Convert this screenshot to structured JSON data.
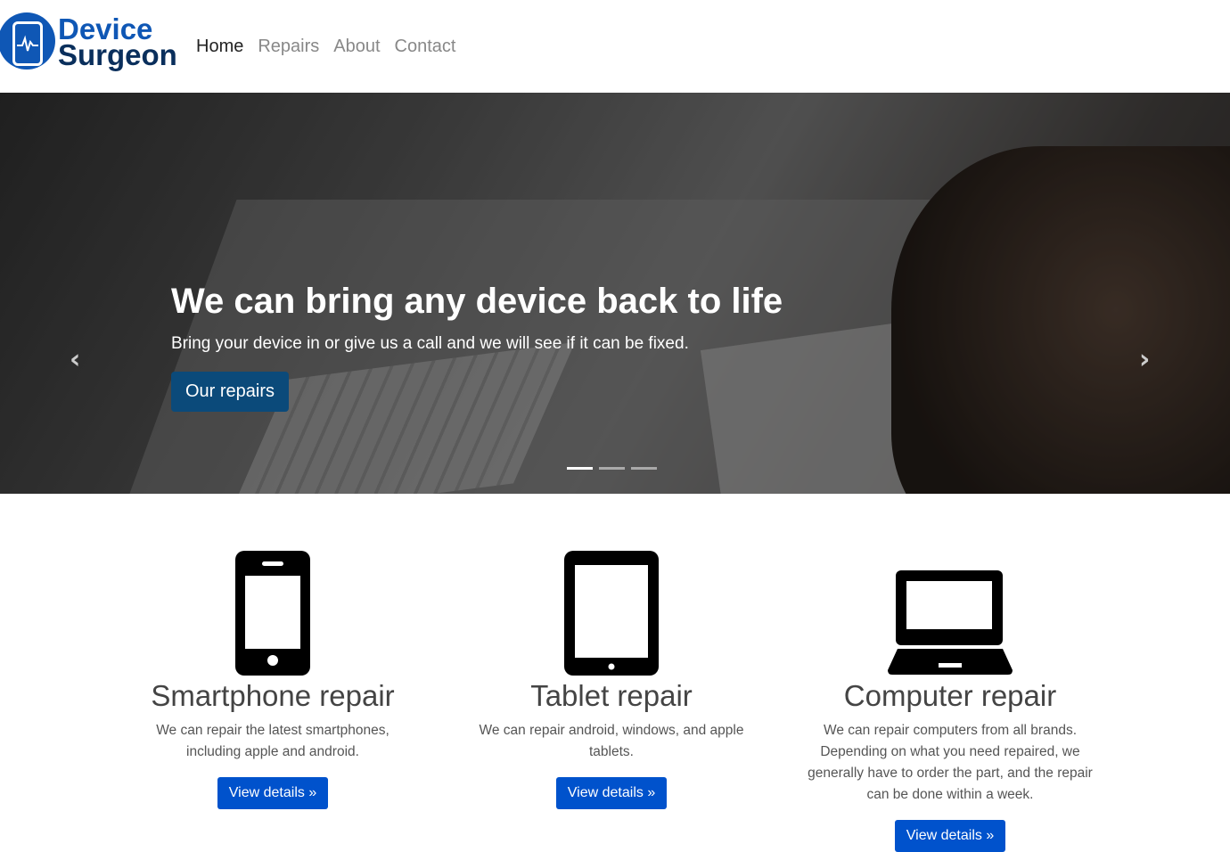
{
  "brand": {
    "line1": "Device",
    "line2": "Surgeon"
  },
  "nav": [
    {
      "label": "Home",
      "active": true
    },
    {
      "label": "Repairs"
    },
    {
      "label": "About"
    },
    {
      "label": "Contact"
    }
  ],
  "hero": {
    "title": "We can bring any device back to life",
    "subtitle": "Bring your device in or give us a call and we will see if it can be fixed.",
    "button": "Our repairs",
    "prev": "‹",
    "next": "›",
    "slides": 3,
    "active_slide": 1
  },
  "services": [
    {
      "icon": "smartphone-icon",
      "title": "Smartphone repair",
      "text": "We can repair the latest smartphones, including apple and android.",
      "button": "View details »"
    },
    {
      "icon": "tablet-icon",
      "title": "Tablet repair",
      "text": "We can repair android, windows, and apple tablets.",
      "button": "View details »"
    },
    {
      "icon": "laptop-icon",
      "title": "Computer repair",
      "text": "We can repair computers from all brands. Depending on what you need repaired, we generally have to order the part, and the repair can be done within a week.",
      "button": "View details »"
    }
  ]
}
